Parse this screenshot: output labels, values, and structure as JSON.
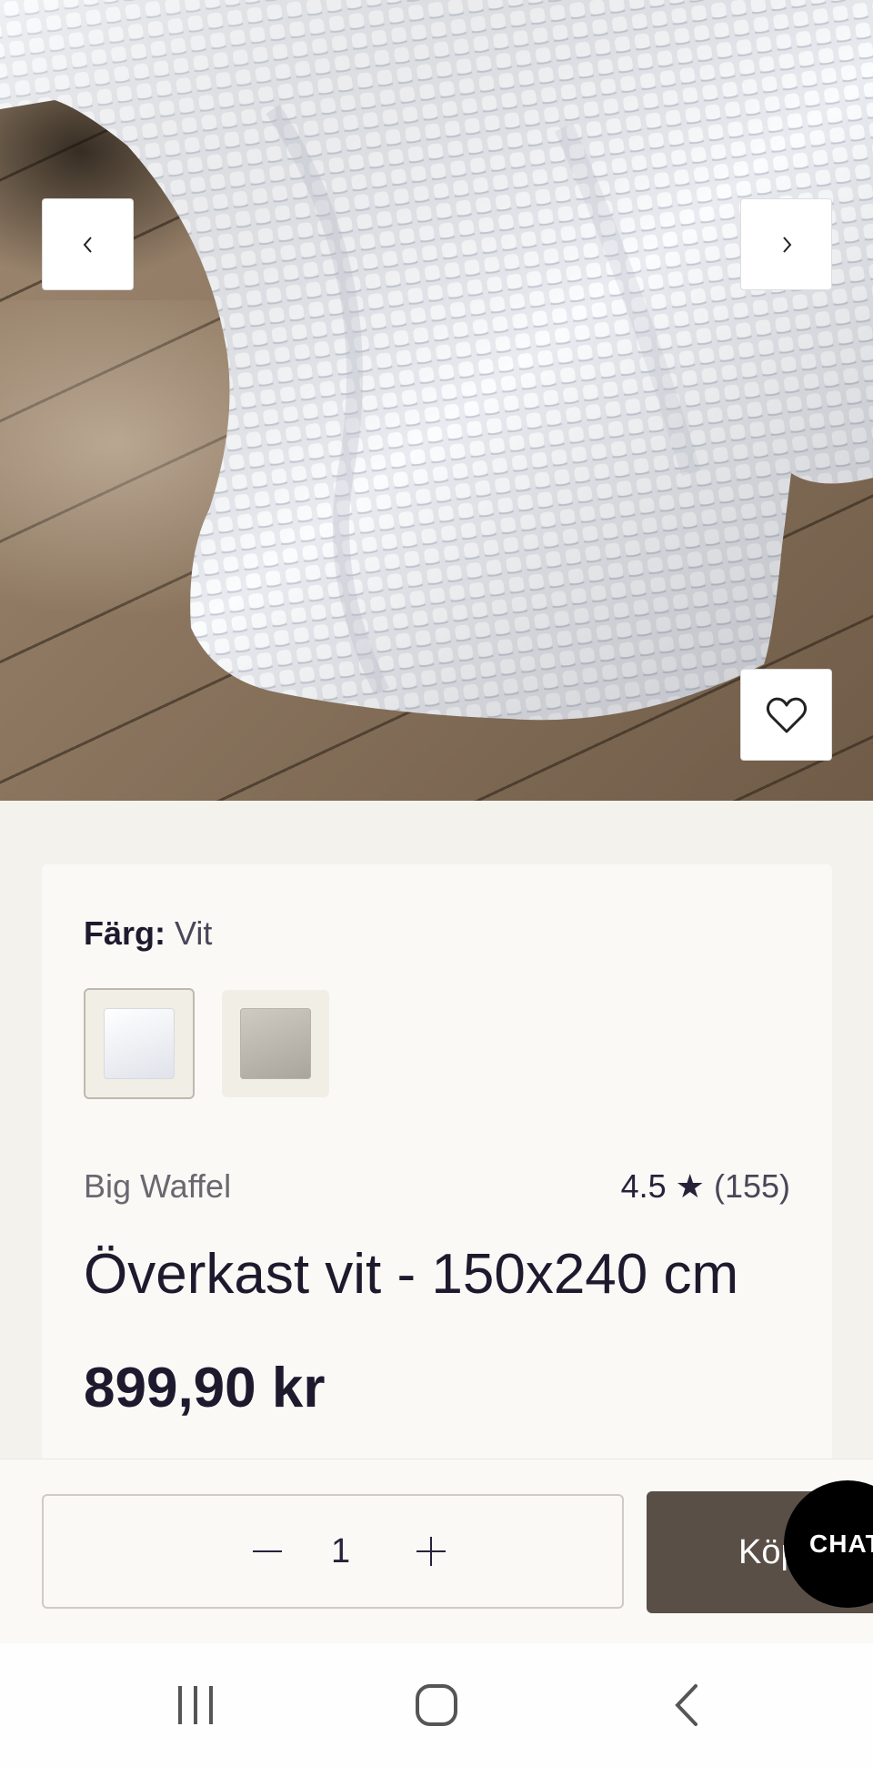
{
  "gallery": {
    "prev_icon": "chevron-left-icon",
    "next_icon": "chevron-right-icon",
    "favorite_icon": "heart-outline-icon"
  },
  "product": {
    "color_label": "Färg:",
    "color_value": "Vit",
    "swatches": [
      {
        "name": "Vit",
        "selected": true
      },
      {
        "name": "grey",
        "selected": false
      }
    ],
    "brand": "Big Waffel",
    "rating_value": "4.5",
    "rating_star": "★",
    "rating_count": "(155)",
    "title": "Överkast vit - 150x240 cm",
    "price": "899,90 kr"
  },
  "buy_bar": {
    "minus": "−",
    "quantity": "1",
    "plus": "+",
    "buy_label": "Köp",
    "chat_label": "CHAT"
  },
  "colors": {
    "background": "#f4f2ed",
    "card": "#faf9f6",
    "buy_button": "#5a4f47",
    "chat_button": "#000000"
  }
}
